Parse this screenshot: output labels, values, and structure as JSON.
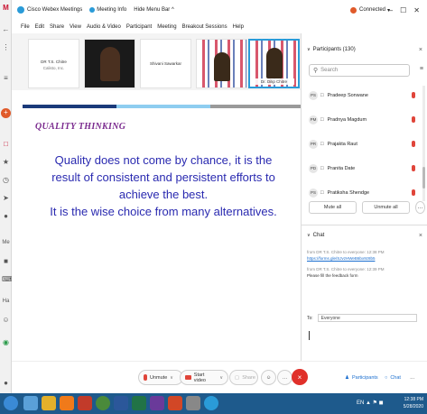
{
  "window": {
    "app_title": "Cisco Webex Meetings",
    "meeting_info": "Meeting Info",
    "hide_menu": "Hide Menu Bar ^",
    "status": "Connected",
    "status_chevron": "▾",
    "win_controls": [
      "–",
      "☐",
      "✕"
    ]
  },
  "menu": [
    "File",
    "Edit",
    "Share",
    "View",
    "Audio & Video",
    "Participant",
    "Meeting",
    "Breakout Sessions",
    "Help"
  ],
  "video_tiles": [
    {
      "name": "DR T.S. Chitre",
      "subtitle": "Calisto, Inc."
    },
    {
      "name": ""
    },
    {
      "name": "Shivani Sawarkar"
    },
    {
      "name": ""
    },
    {
      "name": "Dr. Dilip Chitre"
    }
  ],
  "slide": {
    "title": "QUALITY THINKING",
    "lines": [
      "Quality does not come by chance, it is the",
      "result of consistent and persistent efforts to",
      "achieve the best.",
      "It is the wise choice from many alternatives."
    ],
    "stripe_colors": [
      "#1a3a7a",
      "#8ecdf0",
      "#9a9a9a"
    ]
  },
  "participants": {
    "header": "Participants (130)",
    "search_placeholder": "Search",
    "items": [
      {
        "initials": "PS",
        "name": "Pradeep Sonwane"
      },
      {
        "initials": "PM",
        "name": "Pradnya Magdum"
      },
      {
        "initials": "PR",
        "name": "Prajakta Raut"
      },
      {
        "initials": "PD",
        "name": "Pranita Date"
      },
      {
        "initials": "PS",
        "name": "Pratiksha Shendge"
      }
    ],
    "mute_all": "Mute all",
    "unmute_all": "Unmute all"
  },
  "chat": {
    "header": "Chat",
    "messages": [
      {
        "meta": "from DR T.S. Chitre to everyone:   12:38 PM",
        "text": "https://forms.gle/SJvzHWeB6bx9z8b5",
        "is_link": true
      },
      {
        "meta": "from DR T.S. Chitre to everyone:   12:39 PM",
        "text": "Please fill the feedback form",
        "is_link": false
      }
    ],
    "to_label": "To:",
    "to_value": "Everyone"
  },
  "controls": {
    "unmute": "Unmute",
    "start_video": "Start video",
    "share": "Share",
    "participants": "Participants",
    "chat": "Chat"
  },
  "taskbar": {
    "tray": "EN",
    "time": "12:38 PM",
    "date": "5/28/2020"
  }
}
